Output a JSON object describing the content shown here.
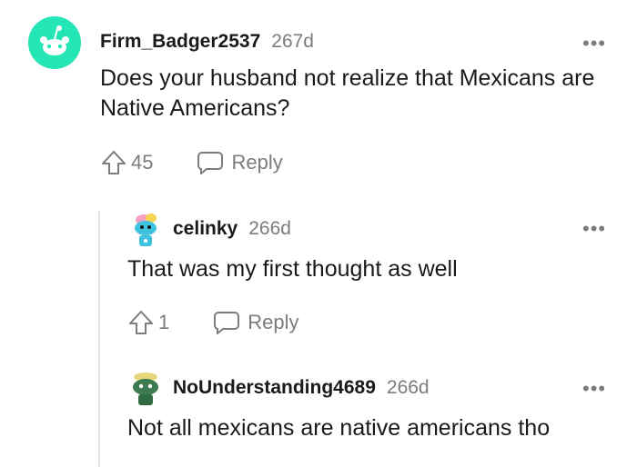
{
  "comments": [
    {
      "username": "Firm_Badger2537",
      "age": "267d",
      "body": "Does your husband not realize that Mexicans are Native Americans?",
      "votes": "45",
      "reply_label": "Reply",
      "avatar": "snoo-teal-avatar"
    },
    {
      "username": "celinky",
      "age": "266d",
      "body": "That was my first thought as well",
      "votes": "1",
      "reply_label": "Reply",
      "avatar": "snoo-custom-blue-avatar"
    },
    {
      "username": "NoUnderstanding4689",
      "age": "266d",
      "body": "Not all mexicans are native americans tho",
      "avatar": "snoo-custom-green-avatar"
    }
  ],
  "more_label": "•••",
  "colors": {
    "meta": "#7c7c7c",
    "text": "#1a1a1b",
    "avatar_teal": "#24e5b5",
    "thread_line": "#e5e5e5"
  }
}
